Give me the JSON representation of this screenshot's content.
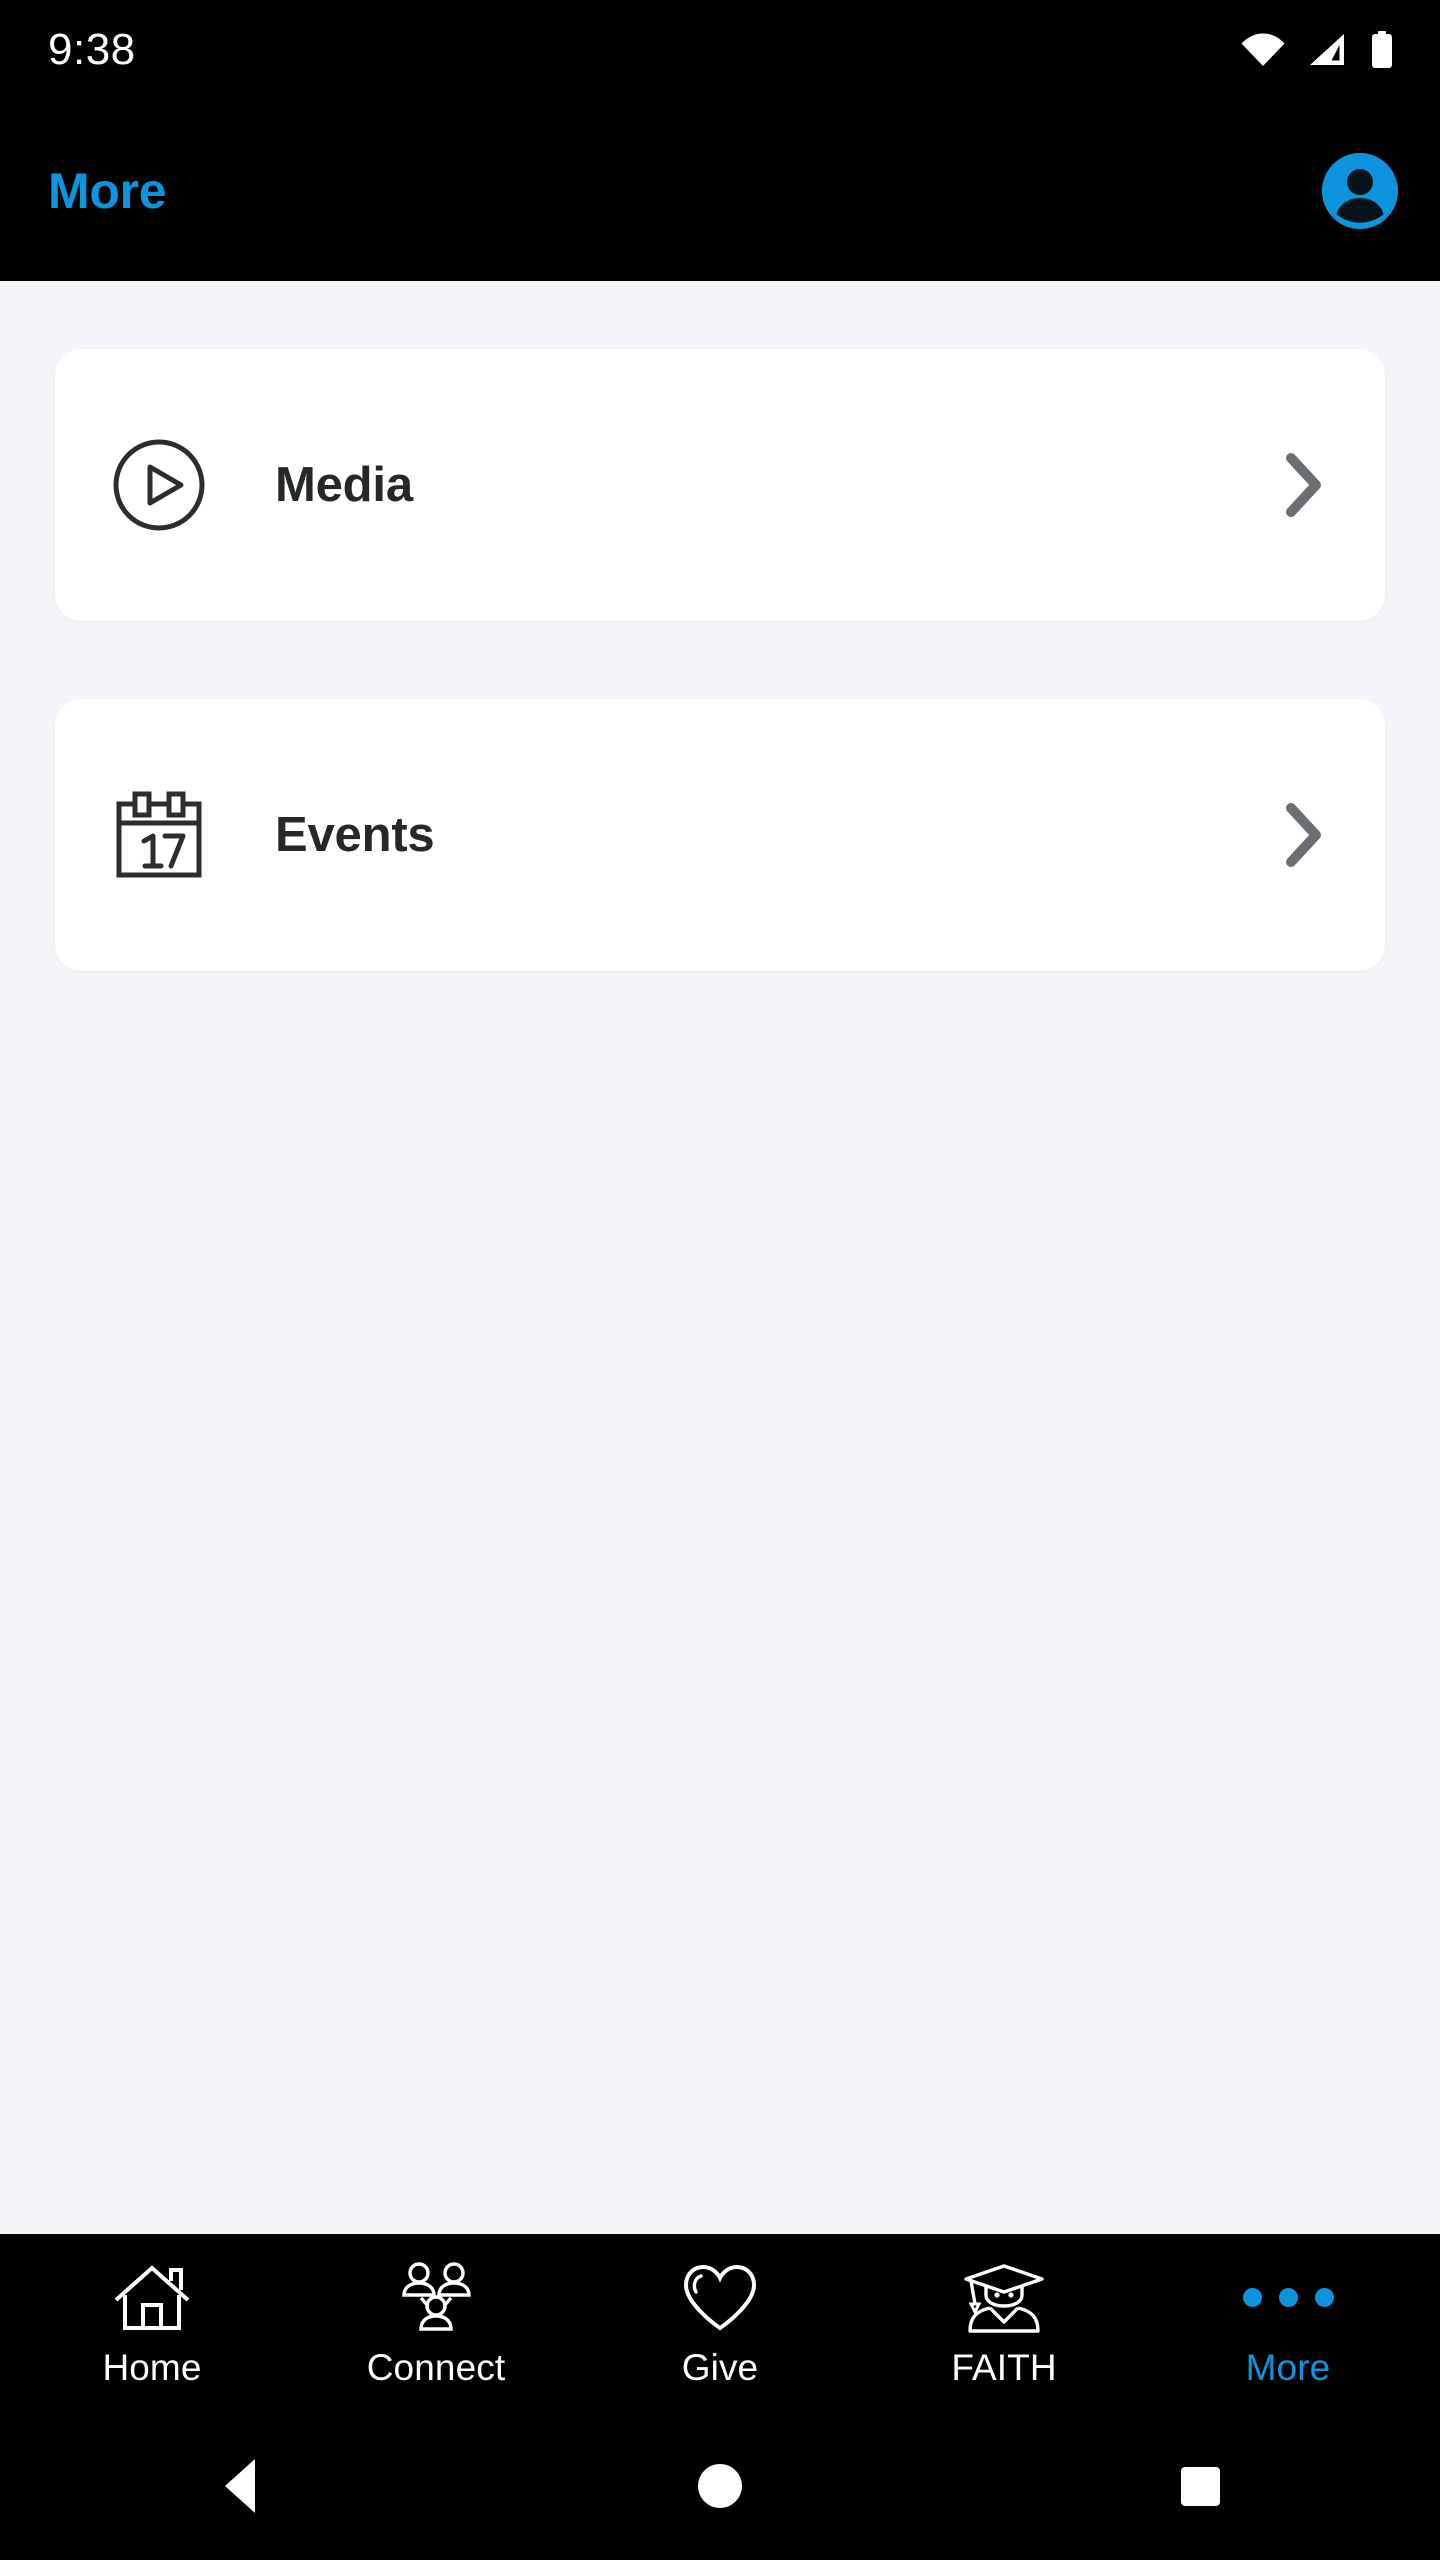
{
  "status_bar": {
    "time": "9:38",
    "icons": [
      "wifi-icon",
      "cellular-signal-icon",
      "battery-icon"
    ]
  },
  "app_bar": {
    "title": "More",
    "title_color": "#0C94DE",
    "background_color": "#000000",
    "avatar_icon": "account-avatar-icon",
    "avatar_color": "#0C94DE"
  },
  "content": {
    "background_color": "#F3F5F8",
    "card_background_color": "#FFFFFF",
    "chevron_color": "#6B6F73",
    "label_color": "#25282B",
    "items": [
      {
        "label": "Media",
        "icon": "play-circle-icon",
        "chevron": "chevron-right-icon"
      },
      {
        "label": "Events",
        "icon": "calendar-17-icon",
        "chevron": "chevron-right-icon"
      }
    ]
  },
  "tab_bar": {
    "background_color": "#000000",
    "active_color": "#0C94DE",
    "inactive_color": "#FFFFFF",
    "items": [
      {
        "label": "Home",
        "icon": "house-icon",
        "active": false
      },
      {
        "label": "Connect",
        "icon": "people-group-icon",
        "active": false
      },
      {
        "label": "Give",
        "icon": "heart-icon",
        "active": false
      },
      {
        "label": "FAITH",
        "icon": "graduate-icon",
        "active": false
      },
      {
        "label": "More",
        "icon": "three-dots-icon",
        "active": true
      }
    ]
  },
  "system_nav": {
    "background_color": "#000000",
    "buttons": [
      "back-icon",
      "home-icon",
      "recents-icon"
    ]
  }
}
